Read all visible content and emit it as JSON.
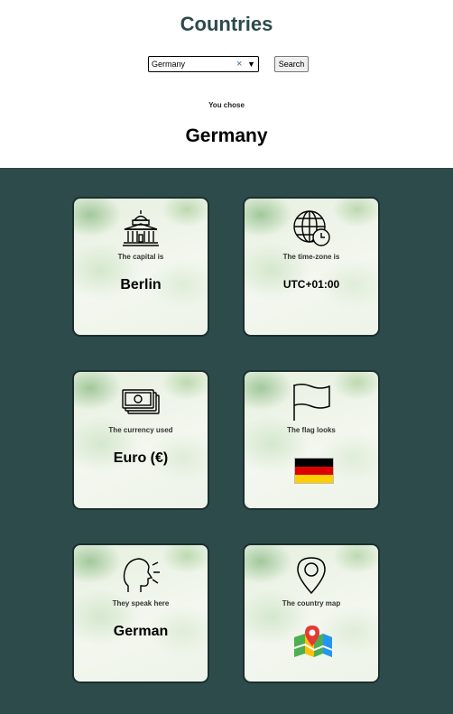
{
  "header": {
    "title": "Countries",
    "search": {
      "value": "Germany",
      "clear_icon": "×",
      "dropdown_icon": "▼"
    },
    "search_button_label": "Search",
    "you_chose_label": "You chose",
    "chosen_country": "Germany"
  },
  "cards": {
    "capital": {
      "icon": "capitol-building-icon",
      "label": "The capital is",
      "value": "Berlin"
    },
    "timezone": {
      "icon": "globe-clock-icon",
      "label": "The time-zone is",
      "value": "UTC+01:00"
    },
    "currency": {
      "icon": "banknotes-icon",
      "label": "The currency used",
      "value": "Euro (€)"
    },
    "flag": {
      "icon": "flag-icon",
      "label": "The flag looks",
      "colors": [
        "#000000",
        "#dd0000",
        "#ffce00"
      ]
    },
    "language": {
      "icon": "speaking-head-icon",
      "label": "They speak here",
      "value": "German"
    },
    "map": {
      "icon": "location-pin-icon",
      "label": "The country map",
      "link_icon": "map-link-icon"
    }
  },
  "colors": {
    "title": "#2c4a4a",
    "panel_background": "#2e4b4b",
    "card_border": "#1c2f2f"
  }
}
